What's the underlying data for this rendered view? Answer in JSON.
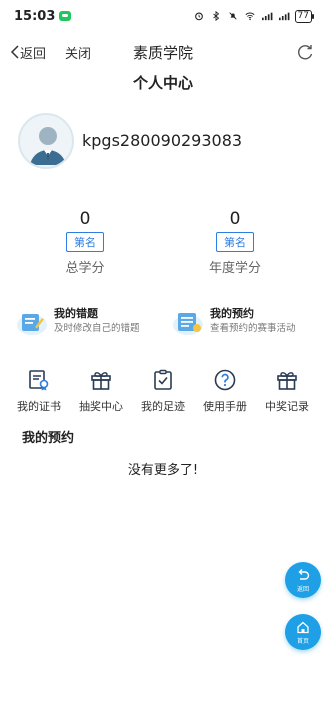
{
  "status_bar": {
    "time": "15:03",
    "battery": "77"
  },
  "nav": {
    "back_label": "返回",
    "close_label": "关闭",
    "title": "素质学院"
  },
  "page_title": "个人中心",
  "profile": {
    "username": "kpgs280090293083"
  },
  "stats": {
    "total": {
      "value": "0",
      "rank_label": "第名",
      "label": "总学分"
    },
    "year": {
      "value": "0",
      "rank_label": "第名",
      "label": "年度学分"
    }
  },
  "features": [
    {
      "title": "我的错题",
      "subtitle": "及时修改自己的错题"
    },
    {
      "title": "我的预约",
      "subtitle": "查看预约的赛事活动"
    }
  ],
  "shortcuts": [
    {
      "label": "我的证书",
      "icon": "certificate-icon"
    },
    {
      "label": "抽奖中心",
      "icon": "gift-icon"
    },
    {
      "label": "我的足迹",
      "icon": "checklist-icon"
    },
    {
      "label": "使用手册",
      "icon": "help-icon"
    },
    {
      "label": "中奖记录",
      "icon": "gift-icon"
    }
  ],
  "section_title": "我的预约",
  "empty_text": "没有更多了!",
  "floating": {
    "back_label": "返回",
    "home_label": "首页"
  },
  "colors": {
    "accent": "#2f7de1",
    "fab": "#1e9fe6"
  }
}
